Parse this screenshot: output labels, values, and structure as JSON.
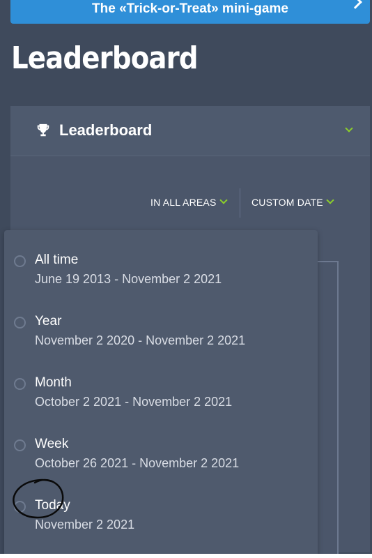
{
  "banner": {
    "text": "The «Trick-or-Treat» mini-game"
  },
  "page": {
    "title": "Leaderboard"
  },
  "panel": {
    "title": "Leaderboard"
  },
  "filters": {
    "area_label": "IN ALL AREAS",
    "date_label": "CUSTOM DATE"
  },
  "options": [
    {
      "label": "All time",
      "range": "June 19 2013 - November 2 2021"
    },
    {
      "label": "Year",
      "range": "November 2 2020 - November 2 2021"
    },
    {
      "label": "Month",
      "range": "October 2 2021 - November 2 2021"
    },
    {
      "label": "Week",
      "range": "October 26 2021 - November 2 2021"
    },
    {
      "label": "Today",
      "range": "November 2 2021"
    }
  ],
  "colors": {
    "background": "#3f4a5c",
    "banner": "#2f8fd8",
    "accent": "#8ccf2a",
    "dropdown": "#4f5a6d"
  },
  "icons": [
    "trophy-icon",
    "chevron-down-icon",
    "chevron-right-icon",
    "radio-icon"
  ]
}
